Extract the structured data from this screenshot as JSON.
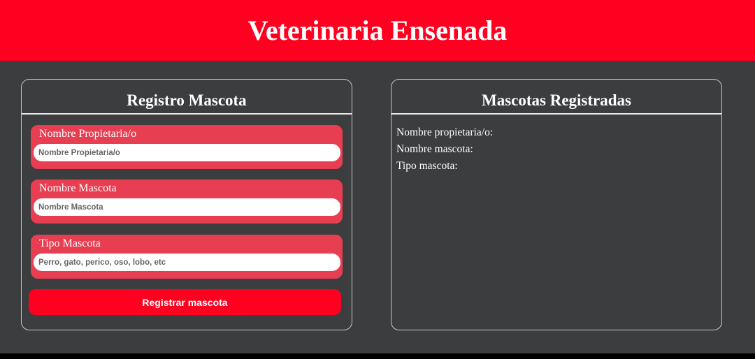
{
  "header": {
    "title": "Veterinaria Ensenada"
  },
  "form": {
    "title": "Registro Mascota",
    "fields": [
      {
        "label": "Nombre Propietaria/o",
        "placeholder": "Nombre Propietaria/o",
        "value": ""
      },
      {
        "label": "Nombre Mascota",
        "placeholder": "Nombre Mascota",
        "value": ""
      },
      {
        "label": "Tipo Mascota",
        "placeholder": "Perro, gato, perico, oso, lobo, etc",
        "value": ""
      }
    ],
    "submit_label": "Registrar mascota"
  },
  "list": {
    "title": "Mascotas Registradas",
    "owner_label": "Nombre propietaria/o:",
    "pet_label": "Nombre mascota:",
    "type_label": "Tipo mascota:"
  },
  "colors": {
    "brand": "#ff0020",
    "field_bg": "#e83e52",
    "background": "#3c3d3f"
  }
}
